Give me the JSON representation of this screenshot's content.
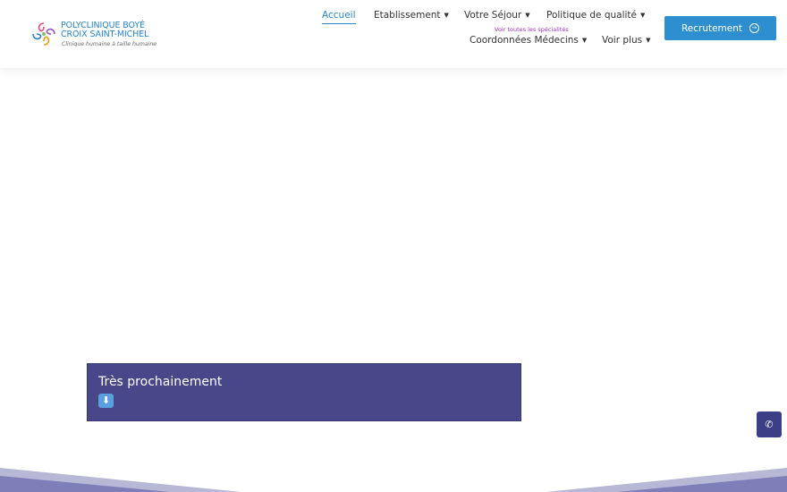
{
  "brand": {
    "name_line1": "POLYCLINIQUE BOYÉ",
    "name_line2": "CROIX SAINT-MICHEL",
    "tagline": "Clinique humaine à taille humaine"
  },
  "nav": {
    "items": [
      {
        "label": "Accueil",
        "active": true
      },
      {
        "label": "Etablissement",
        "dropdown": true
      },
      {
        "label": "Votre Séjour",
        "dropdown": true
      },
      {
        "label": "Politique de qualité",
        "dropdown": true
      },
      {
        "label": "Coordonnées Médecins",
        "dropdown": true,
        "sublabel": "Voir toutes les spécialités"
      },
      {
        "label": "Voir plus",
        "dropdown": true
      }
    ],
    "caret": "▼"
  },
  "recruit_button": {
    "label": "Recrutement",
    "icon": "arrow-right-circle-icon",
    "arrow_glyph": "→"
  },
  "promo": {
    "title": "Très prochainement",
    "icon": "down-arrow-emoji-icon",
    "icon_glyph": "⬇"
  },
  "phone_button": {
    "icon": "phone-icon",
    "glyph": "✆"
  },
  "colors": {
    "accent": "#2a84c6",
    "button": "#2d8fd0",
    "promo_bg": "#474789",
    "phone_bg": "#3a3f86",
    "sublabel": "#9c35b5",
    "wave": "#b7b7d6"
  }
}
